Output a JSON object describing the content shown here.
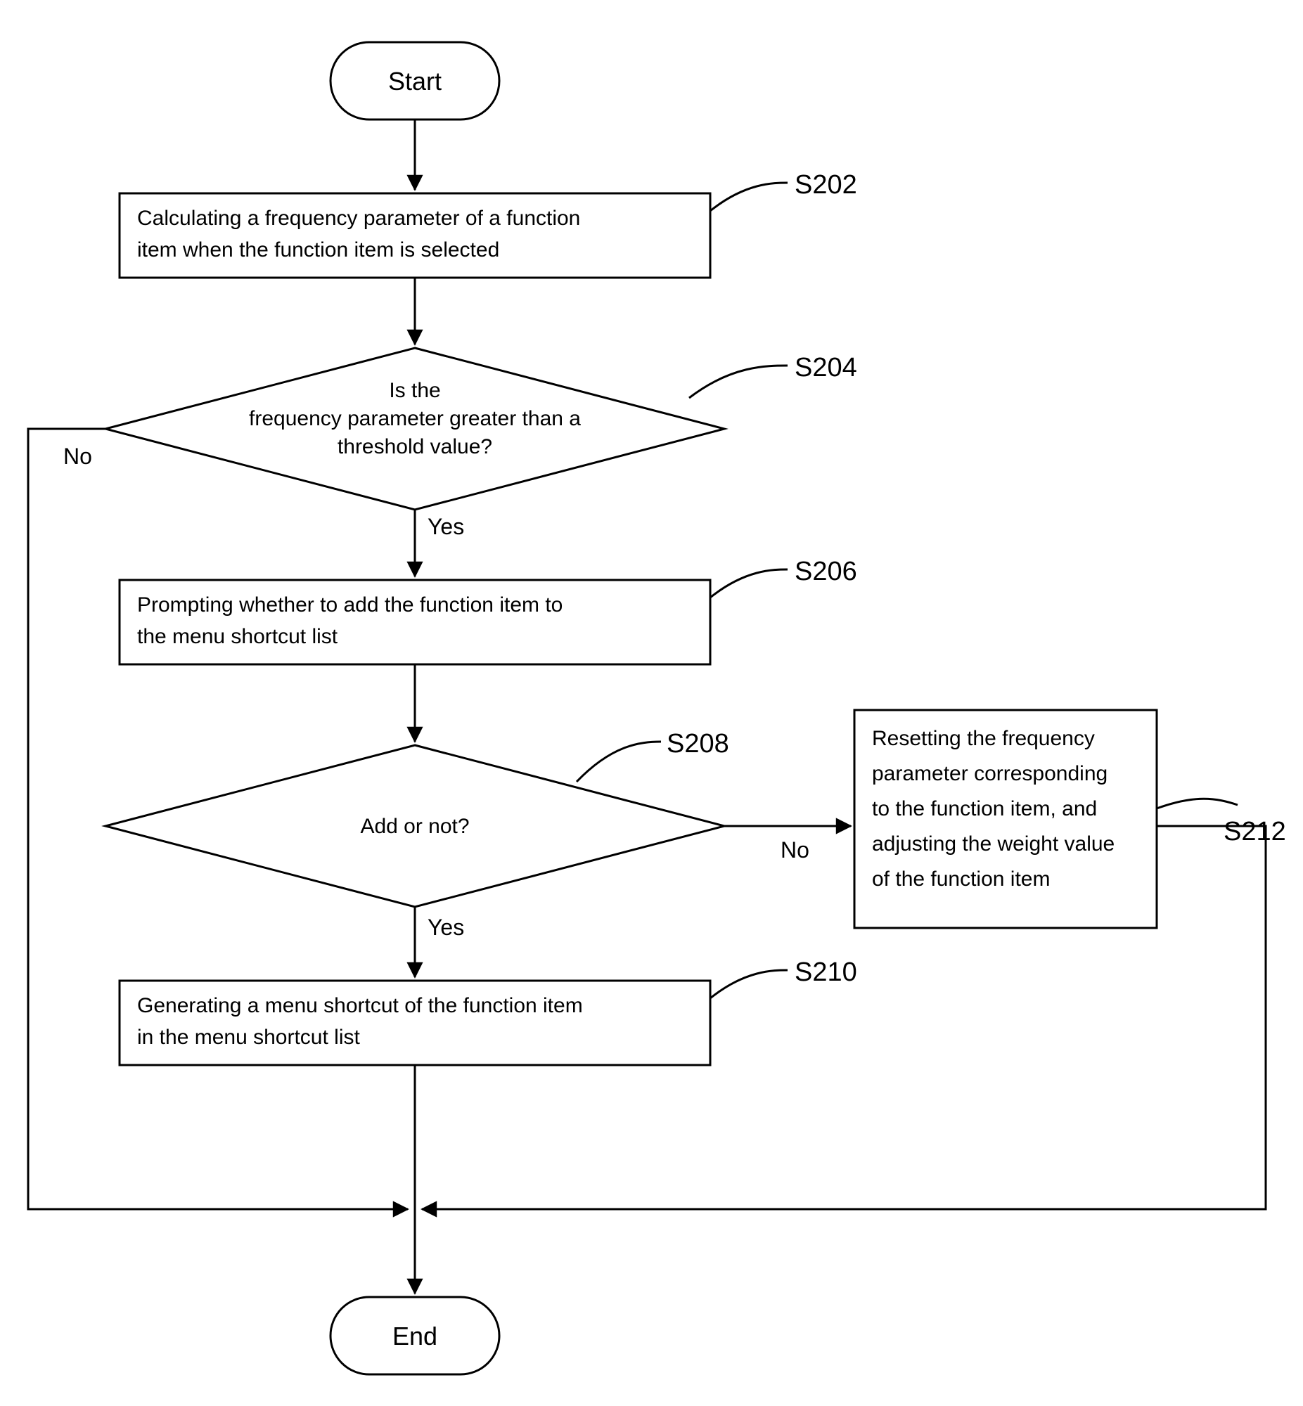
{
  "chart_data": {
    "type": "flowchart",
    "title": "",
    "nodes": [
      {
        "id": "start",
        "kind": "terminator",
        "text": "Start"
      },
      {
        "id": "s202",
        "kind": "process",
        "label": "S202",
        "text_lines": [
          "Calculating a frequency parameter of a function",
          "item when the function item is selected"
        ]
      },
      {
        "id": "s204",
        "kind": "decision",
        "label": "S204",
        "text_lines": [
          "Is the",
          "frequency parameter greater than a",
          "threshold value?"
        ]
      },
      {
        "id": "s206",
        "kind": "process",
        "label": "S206",
        "text_lines": [
          "Prompting whether to add the function item to",
          "the menu shortcut list"
        ]
      },
      {
        "id": "s208",
        "kind": "decision",
        "label": "S208",
        "text_lines": [
          "Add or not?"
        ]
      },
      {
        "id": "s210",
        "kind": "process",
        "label": "S210",
        "text_lines": [
          "Generating a menu shortcut of the function item",
          "in the menu shortcut list"
        ]
      },
      {
        "id": "s212",
        "kind": "process",
        "label": "S212",
        "text_lines": [
          "Resetting the frequency",
          "parameter corresponding",
          "to the function item, and",
          "adjusting the weight value",
          "of the function item"
        ]
      },
      {
        "id": "end",
        "kind": "terminator",
        "text": "End"
      }
    ],
    "edges": [
      {
        "from": "start",
        "to": "s202",
        "label": ""
      },
      {
        "from": "s202",
        "to": "s204",
        "label": ""
      },
      {
        "from": "s204",
        "to": "s206",
        "label": "Yes"
      },
      {
        "from": "s204",
        "to": "end",
        "label": "No"
      },
      {
        "from": "s206",
        "to": "s208",
        "label": ""
      },
      {
        "from": "s208",
        "to": "s210",
        "label": "Yes"
      },
      {
        "from": "s208",
        "to": "s212",
        "label": "No"
      },
      {
        "from": "s210",
        "to": "end",
        "label": ""
      },
      {
        "from": "s212",
        "to": "end",
        "label": ""
      }
    ]
  }
}
